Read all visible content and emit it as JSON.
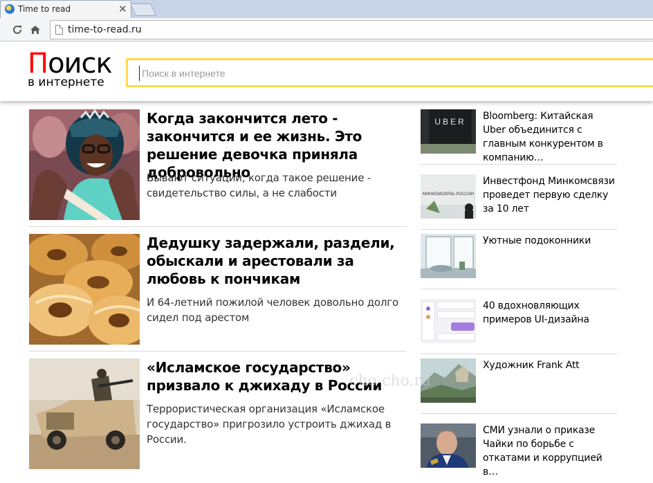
{
  "browser": {
    "tab_title": "Time to read",
    "url": "time-to-read.ru"
  },
  "header": {
    "logo_first_letter": "П",
    "logo_rest": "оиск",
    "logo_subtitle": "в интернете",
    "search_placeholder": "Поиск в интернете"
  },
  "articles": [
    {
      "title": "Когда закончится лето - закончится и ее жизнь. Это решение девочка приняла добровольно",
      "description": "Бывают ситуации, когда такое решение - свидетельство силы, а не слабости"
    },
    {
      "title": "Дедушку задержали, раздели, обыскали и арестовали за любовь к пончикам",
      "description": "И 64-летний пожилой человек довольно долго сидел под арестом"
    },
    {
      "title": "«Исламское государство» призвало к джихаду в России",
      "description": "Террористическая организация «Исламское государство» пригрозило устроить джихад в России."
    }
  ],
  "sidebar": [
    {
      "title": "Bloomberg: Китайская Uber объединится с главным конкурентом в компанию…",
      "image_text": "UBER"
    },
    {
      "title": "Инвестфонд Минкомсвязи проведет первую сделку за 10 лет",
      "image_text": "МИНКОМСВЯЗЬ РОССИИ"
    },
    {
      "title": "Уютные подоконники"
    },
    {
      "title": "40 вдохновляющих примеров UI-дизайна"
    },
    {
      "title": "Художник Frank Att"
    },
    {
      "title": "СМИ узнали о приказе Чайки по борьбе с откатами и коррупцией в…"
    }
  ],
  "watermark": "cho-cho.ru",
  "colors": {
    "logo_red": "#ff0000",
    "search_border": "#ffdb4d"
  }
}
